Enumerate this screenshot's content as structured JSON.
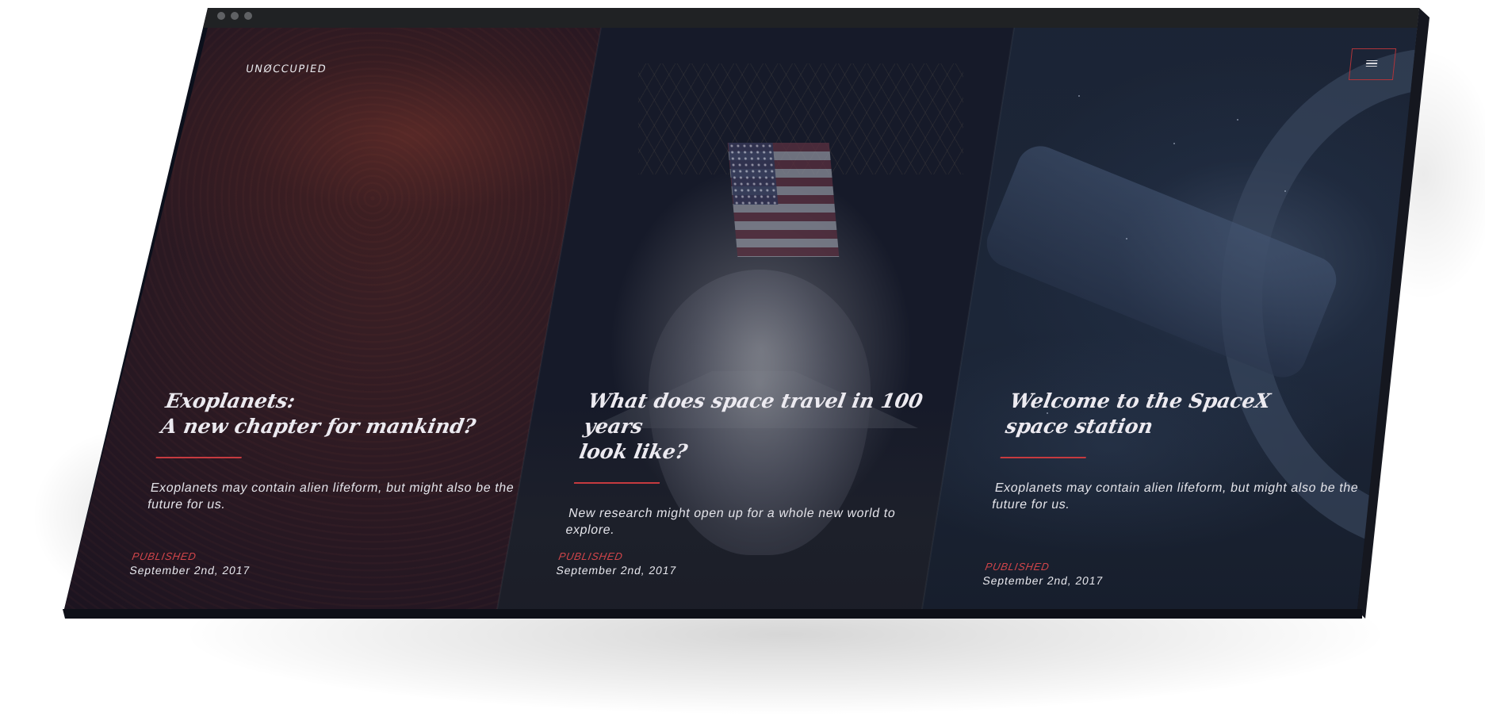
{
  "brand": {
    "logo": "UNØCCUPIED"
  },
  "colors": {
    "accent": "#c63a3f",
    "background": "#0b0f1b",
    "text": "#eceaf0"
  },
  "header": {
    "menu_icon": "hamburger-menu-icon"
  },
  "window": {
    "controls": [
      "window-dot-icon",
      "window-dot-icon",
      "window-dot-icon"
    ]
  },
  "articles": [
    {
      "title": "Exoplanets:\nA new chapter for mankind?",
      "excerpt": "Exoplanets may contain alien lifeform, but might also be the future for us.",
      "published_label": "PUBLISHED",
      "date": "September 2nd, 2017"
    },
    {
      "title": "What does space travel in 100 years\nlook like?",
      "excerpt": "New research might open up for a whole new world to explore.",
      "published_label": "PUBLISHED",
      "date": "September 2nd, 2017"
    },
    {
      "title": "Welcome to the SpaceX\nspace station",
      "excerpt": "Exoplanets may contain alien lifeform, but might also be the future for us.",
      "published_label": "PUBLISHED",
      "date": "September 2nd, 2017"
    }
  ]
}
